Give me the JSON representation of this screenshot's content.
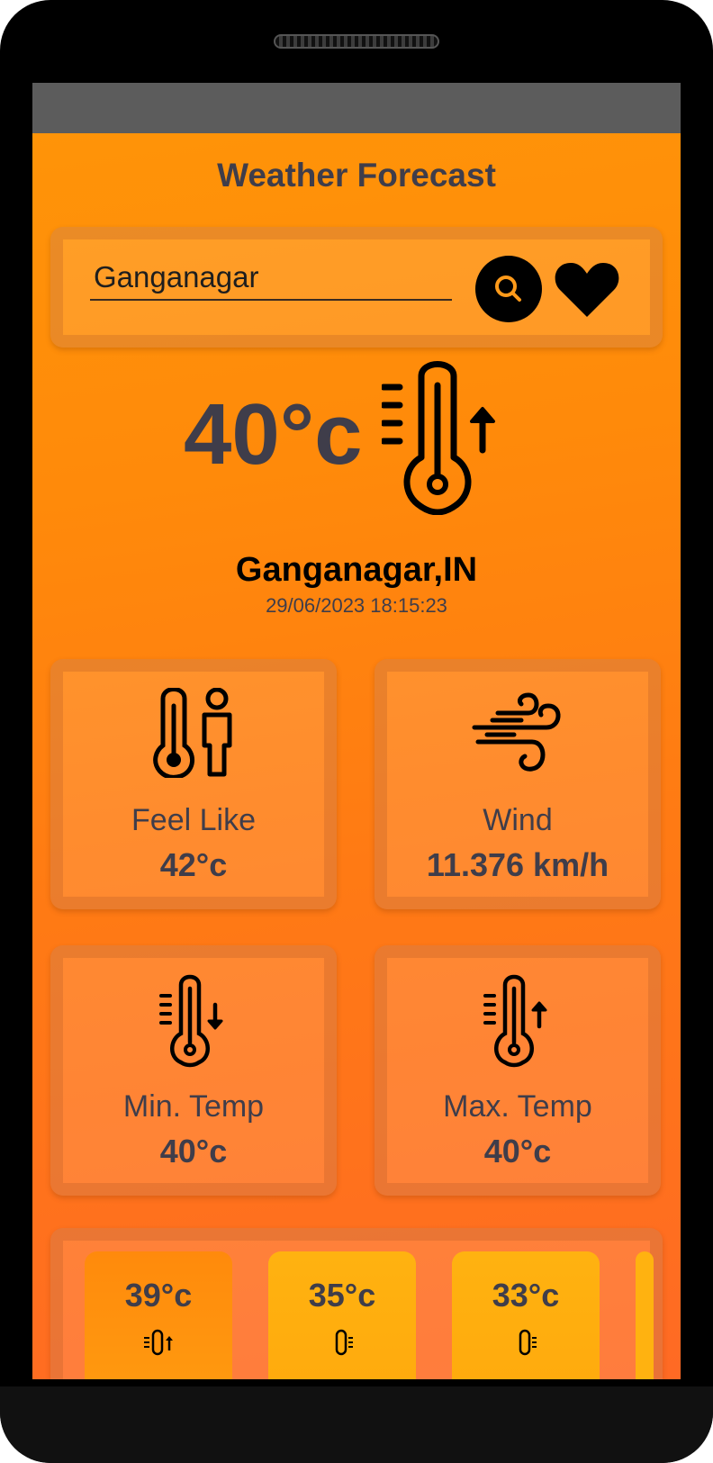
{
  "app": {
    "title": "Weather Forecast"
  },
  "search": {
    "value": "Ganganagar",
    "search_icon": "search-icon",
    "favorite_icon": "heart-icon"
  },
  "current": {
    "temperature": "40°c",
    "icon": "thermometer-up-icon",
    "location": "Ganganagar,IN",
    "datetime": "29/06/2023 18:15:23"
  },
  "details": [
    {
      "label": "Feel Like",
      "value": "42°c",
      "icon": "thermometer-person-icon"
    },
    {
      "label": "Wind",
      "value": "11.376 km/h",
      "icon": "wind-icon"
    },
    {
      "label": "Min. Temp",
      "value": "40°c",
      "icon": "thermometer-down-icon"
    },
    {
      "label": "Max. Temp",
      "value": "40°c",
      "icon": "thermometer-up-icon"
    }
  ],
  "forecast": [
    {
      "temp": "39°c",
      "icon": "thermometer-up-icon"
    },
    {
      "temp": "35°c",
      "icon": "thermometer-icon"
    },
    {
      "temp": "33°c",
      "icon": "thermometer-icon"
    }
  ],
  "colors": {
    "accent": "#ff8c0a",
    "text_dark": "#3f3d4a",
    "forecast_card_1": "#ff8a0c",
    "forecast_card_2": "#ffb210"
  }
}
